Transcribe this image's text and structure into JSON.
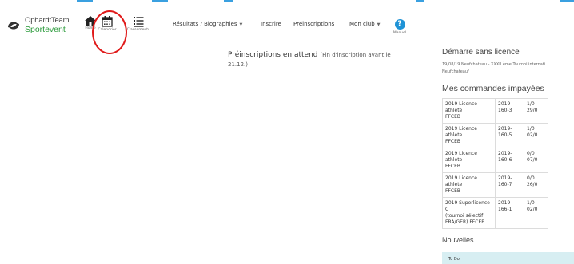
{
  "brand": {
    "line1": "OphardtTeam",
    "line2": "Sportevent"
  },
  "nav": {
    "home_label": "Home",
    "calendar_label": "Calendrier",
    "rankings_label": "Classements",
    "results_label": "Résultats / Biographies",
    "register_label": "Inscrire",
    "preregistrations_label": "Préinscriptions",
    "myclub_label": "Mon club",
    "manual_label": "Manuel",
    "help_glyph": "?",
    "caret": "▼"
  },
  "main": {
    "title": "Préinscriptions en attend",
    "note_line1": "(Fin d'inscription avant le",
    "note_line2": "21.12.)"
  },
  "sidebar": {
    "no_license_title": "Démarre sans licence",
    "event_line1": "19/08/19 Neufchateau - XXXII ème Tournoi internati",
    "event_line2": "Neufchateau/",
    "orders_title": "Mes commandes impayées",
    "orders": [
      {
        "desc": [
          "2019 Licence athlete",
          "FFCEB"
        ],
        "num": [
          "2019-",
          "160-3"
        ],
        "date": [
          "1/0",
          "29/0"
        ]
      },
      {
        "desc": [
          "2019 Licence athlete",
          "FFCEB"
        ],
        "num": [
          "2019-",
          "160-5"
        ],
        "date": [
          "1/0",
          "02/0"
        ]
      },
      {
        "desc": [
          "2019 Licence athlete",
          "FFCEB"
        ],
        "num": [
          "2019-",
          "160-6"
        ],
        "date": [
          "0/0",
          "07/0"
        ]
      },
      {
        "desc": [
          "2019 Licence athlete",
          "FFCEB"
        ],
        "num": [
          "2019-",
          "160-7"
        ],
        "date": [
          "0/0",
          "26/0"
        ]
      },
      {
        "desc": [
          "2019 Superlicence C",
          "(tournoi sélectif",
          "FRA/GER) FFCEB"
        ],
        "num": [
          "2019-",
          "166-1"
        ],
        "date": [
          "1/0",
          "02/0"
        ]
      }
    ],
    "news_title": "Nouvelles",
    "todo_label": "To Do"
  },
  "colors": {
    "accent_blue": "#1f93d6",
    "brand_green": "#2a9a3a",
    "annotation_red": "#e01a1a",
    "todo_bg": "#d7eef2"
  }
}
